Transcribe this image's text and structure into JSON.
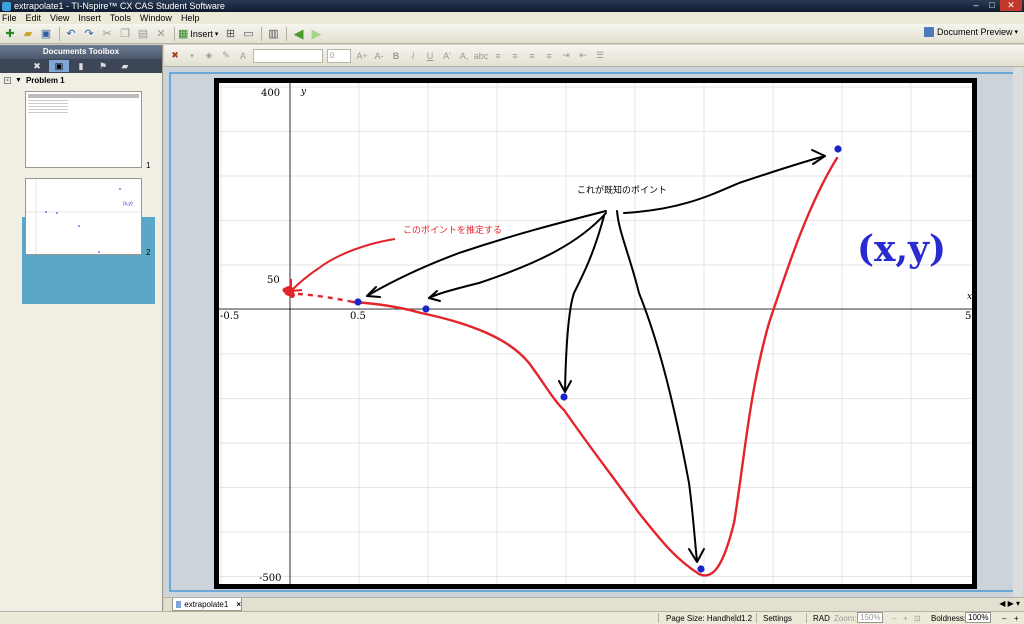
{
  "window": {
    "title": "extrapolate1 - TI-Nspire™ CX CAS Student Software"
  },
  "menu": [
    "File",
    "Edit",
    "View",
    "Insert",
    "Tools",
    "Window",
    "Help"
  ],
  "toolbar": {
    "insert_label": "Insert",
    "document_preview_label": "Document Preview"
  },
  "left_panel": {
    "title": "Documents Toolbox",
    "problem_label": "Problem 1",
    "pages": [
      {
        "number": "1"
      },
      {
        "number": "2",
        "thumb_label": "(x,y)"
      }
    ]
  },
  "format_bar": {
    "size_placeholder": "0"
  },
  "graph": {
    "axis_labels": {
      "x": "x",
      "y": "y"
    },
    "tick_labels": {
      "y_top": "400",
      "y_fifty": "50",
      "y_bottom": "-500",
      "x_left": "-0.5",
      "x_half": "0.5",
      "x_right": "5"
    },
    "annotations": {
      "known_points": "これが既知のポイント",
      "estimate": "このポイントを推定する",
      "xy": "(x,y)"
    },
    "colors": {
      "curve": "#e4242b",
      "point": "#1a24c8",
      "arrow": "#000000",
      "xy_text": "#2a2ad2",
      "grid": "#dcdcdc"
    }
  },
  "doc_tab": {
    "label": "extrapolate1",
    "close": "×"
  },
  "status": {
    "page_size": "Page Size: Handheld",
    "page_number": "1.2",
    "settings": "Settings",
    "mode": "RAD",
    "zoom_label": "Zoom:",
    "zoom_value": "150%",
    "boldness_label": "Boldness:",
    "boldness_value": "100%"
  }
}
